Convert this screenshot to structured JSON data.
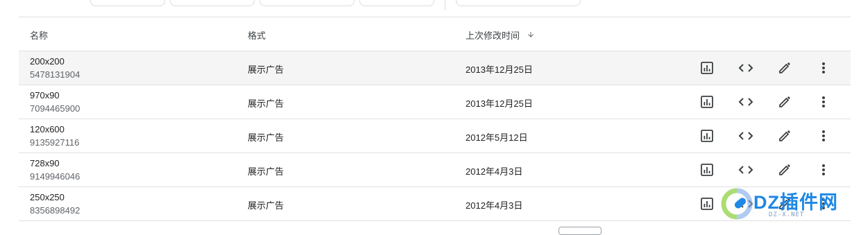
{
  "table": {
    "headers": {
      "name": "名称",
      "format": "格式",
      "modified": "上次修改时间"
    },
    "rows": [
      {
        "name": "200x200",
        "id": "5478131904",
        "format": "展示广告",
        "date": "2013年12月25日"
      },
      {
        "name": "970x90",
        "id": "7094465900",
        "format": "展示广告",
        "date": "2013年12月25日"
      },
      {
        "name": "120x600",
        "id": "9135927116",
        "format": "展示广告",
        "date": "2012年5月12日"
      },
      {
        "name": "728x90",
        "id": "9149946046",
        "format": "展示广告",
        "date": "2012年4月3日"
      },
      {
        "name": "250x250",
        "id": "8356898492",
        "format": "展示广告",
        "date": "2012年4月3日"
      }
    ]
  },
  "icons": {
    "report": "bar-chart-icon",
    "code": "code-icon",
    "edit": "pencil-icon",
    "more": "more-vert-icon",
    "sort": "arrow-down-icon"
  },
  "watermark": {
    "text": "DZ插件网",
    "sub": "DZ-X.NET"
  },
  "colors": {
    "icon": "#3c4043",
    "border": "#e0e0e0",
    "row_highlight": "#f5f5f5",
    "watermark": "#1e88e5"
  }
}
